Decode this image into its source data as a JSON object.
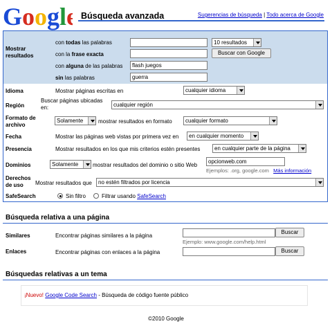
{
  "header": {
    "logo_text": "Google",
    "title": "Búsqueda avanzada",
    "links": [
      "Sugerencias de búsqueda",
      "Acerca de Google"
    ],
    "link_separator": "|",
    "link2_prefix": "Todo acerca de Google"
  },
  "show_results": {
    "label": "Mostrar resultados",
    "rows": [
      {
        "prefix": "con ",
        "bold": "todas",
        "suffix": " las palabras",
        "value": ""
      },
      {
        "prefix": "con la ",
        "bold": "frase exacta",
        "suffix": "",
        "value": ""
      },
      {
        "prefix": "con ",
        "bold": "alguna",
        "suffix": " de las palabras",
        "value": "flash juegos"
      },
      {
        "prefix": "",
        "bold": "sin",
        "suffix": " las palabras",
        "value": "guerra"
      }
    ],
    "results_select": "10 resultados",
    "search_button": "Buscar con Google"
  },
  "options": {
    "language": {
      "label": "Idioma",
      "text": "Mostrar páginas escritas en",
      "value": "cualquier idioma"
    },
    "region": {
      "label": "Región",
      "text": "Buscar páginas ubicadas en:",
      "value": "cualquier región"
    },
    "format": {
      "label": "Formato de archivo",
      "mode": "Solamente",
      "text": "mostrar resultados en formato",
      "value": "cualquier formato"
    },
    "date": {
      "label": "Fecha",
      "text": "Mostrar las páginas web vistas por primera vez en",
      "value": "en cualquier momento"
    },
    "occurrences": {
      "label": "Presencia",
      "text": "Mostrar resultados en los que mis criterios estén presentes",
      "value": "en cualquier parte de la página"
    },
    "domains": {
      "label": "Dominios",
      "mode": "Solamente",
      "text": "mostrar resultados del dominio o sitio Web",
      "value": "opcionweb.com",
      "example": "Ejemplos: .org, google.com",
      "more_info": "Más información"
    },
    "rights": {
      "label": "Derechos de uso",
      "text": "Mostrar resultados que",
      "value": "no estén filtrados por licencia"
    },
    "safesearch": {
      "label": "SafeSearch",
      "off": "Sin filtro",
      "on_prefix": "Filtrar usando ",
      "on_link": "SafeSearch"
    }
  },
  "page_specific": {
    "title": "Búsqueda relativa a una página",
    "similar": {
      "label": "Similares",
      "text": "Encontrar páginas similares a la página",
      "button": "Buscar",
      "example": "Ejemplo: www.google.com/help.html"
    },
    "links": {
      "label": "Enlaces",
      "text": "Encontrar páginas con enlaces a la página",
      "button": "Buscar"
    }
  },
  "topic_specific": {
    "title": "Búsquedas relativas a un tema",
    "new_label": "¡Nuevo!",
    "link": "Google Code Search",
    "description": " - Búsqueda de código fuente público"
  },
  "footer": {
    "text": "©2010 Google"
  },
  "colors": {
    "accent": "#3366cc",
    "band": "#cbdced",
    "link": "#0000cc"
  }
}
